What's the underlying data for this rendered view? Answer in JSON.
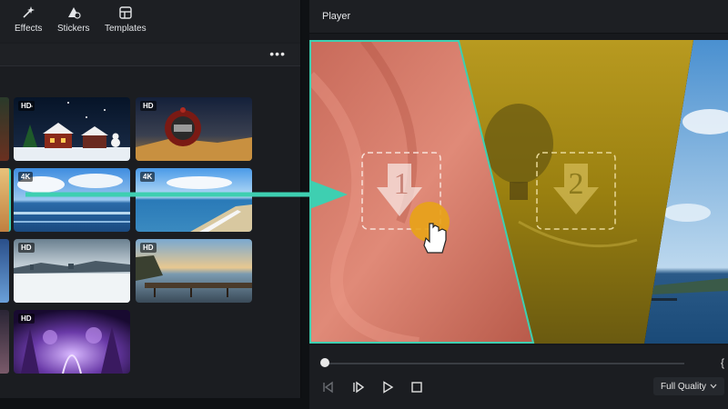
{
  "toolbar": {
    "effects_label": "Effects",
    "stickers_label": "Stickers",
    "templates_label": "Templates"
  },
  "media_grid": {
    "more_label": "•••",
    "thumbnails": [
      {
        "name": "christmas-village",
        "badge": "HD"
      },
      {
        "name": "robot-desert",
        "badge": "HD"
      },
      {
        "name": "ocean-clouds",
        "badge": "4K"
      },
      {
        "name": "beach-coast",
        "badge": "4K"
      },
      {
        "name": "snow-coast",
        "badge": "HD"
      },
      {
        "name": "pier-sunset",
        "badge": "HD"
      },
      {
        "name": "fantasy-forest",
        "badge": "HD"
      }
    ]
  },
  "player": {
    "title": "Player",
    "slot_1": "1",
    "slot_2": "2",
    "brace": "{",
    "quality_label": "Full Quality",
    "progress": 0
  },
  "colors": {
    "accent_teal": "#3ecfb1",
    "cursor_orange": "#e8a317"
  }
}
